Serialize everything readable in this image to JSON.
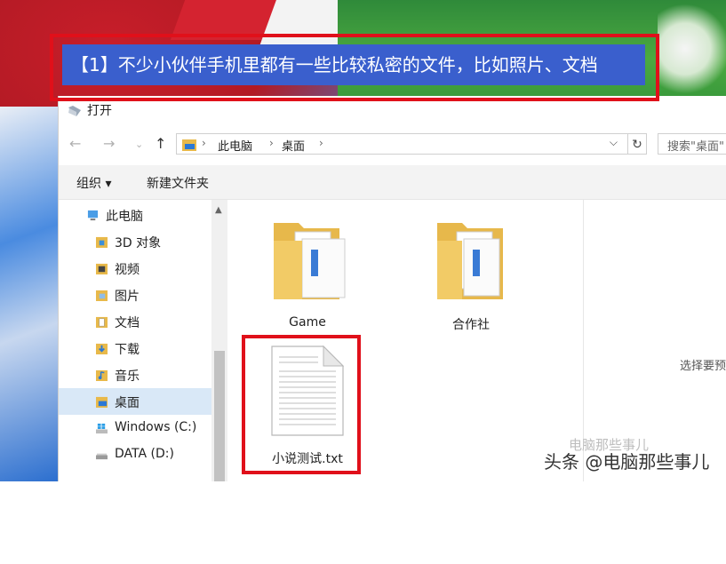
{
  "banner": {
    "text": "【1】不少小伙伴手机里都有一些比较私密的文件，比如照片、文档"
  },
  "dialog": {
    "title": "打开",
    "address": {
      "crumbs": [
        "此电脑",
        "桌面"
      ]
    },
    "search_placeholder": "搜索\"桌面\"",
    "toolbar": {
      "organize": "组织 ▾",
      "new_folder": "新建文件夹"
    },
    "sidebar": {
      "items": [
        {
          "label": "此电脑",
          "icon": "computer-icon"
        },
        {
          "label": "3D 对象",
          "icon": "3d-objects-icon"
        },
        {
          "label": "视频",
          "icon": "video-icon"
        },
        {
          "label": "图片",
          "icon": "pictures-icon"
        },
        {
          "label": "文档",
          "icon": "documents-icon"
        },
        {
          "label": "下载",
          "icon": "download-icon"
        },
        {
          "label": "音乐",
          "icon": "music-icon"
        },
        {
          "label": "桌面",
          "icon": "desktop-icon"
        },
        {
          "label": "Windows (C:)",
          "icon": "drive-icon"
        },
        {
          "label": "DATA (D:)",
          "icon": "drive-icon"
        }
      ],
      "selected": "桌面"
    },
    "files": [
      {
        "name": "Game",
        "type": "folder"
      },
      {
        "name": "合作社",
        "type": "folder"
      },
      {
        "name": "小说测试.txt",
        "type": "text-file"
      }
    ],
    "preview_message": "选择要预"
  },
  "watermark": {
    "main": "头条 @电脑那些事儿",
    "faint": "电脑那些事儿"
  },
  "colors": {
    "highlight": "#e0101a",
    "banner_bg": "#3a5fcd",
    "selected_bg": "#d9e8f7"
  }
}
